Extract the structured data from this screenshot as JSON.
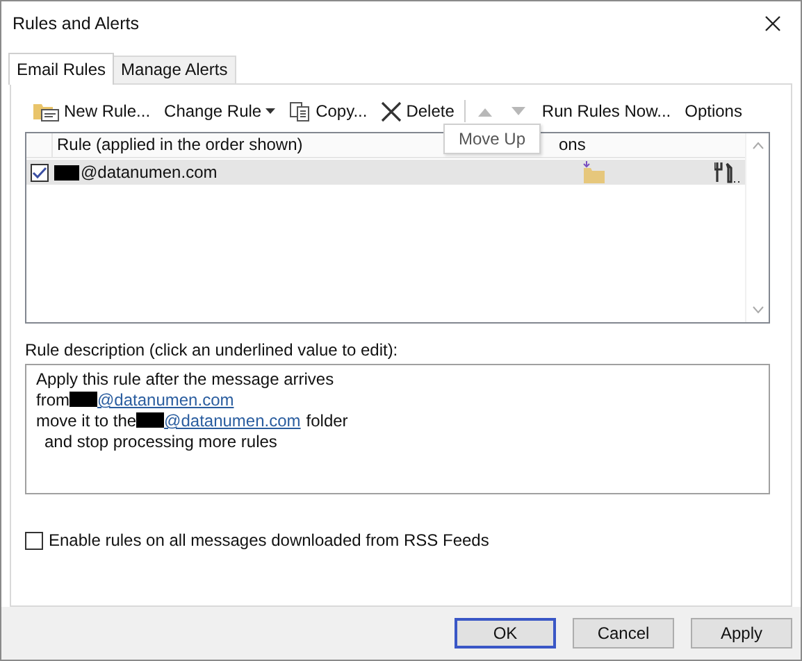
{
  "window": {
    "title": "Rules and Alerts"
  },
  "tabs": [
    {
      "label": "Email Rules",
      "selected": true
    },
    {
      "label": "Manage Alerts",
      "selected": false
    }
  ],
  "toolbar": [
    {
      "kind": "new",
      "label": "New Rule...",
      "disabled": false
    },
    {
      "kind": "dropdown",
      "label": "Change Rule",
      "disabled": false
    },
    {
      "kind": "copy",
      "label": "Copy...",
      "disabled": false
    },
    {
      "kind": "delete",
      "label": "Delete",
      "disabled": false
    },
    {
      "kind": "up",
      "disabled": true
    },
    {
      "kind": "down",
      "disabled": true
    },
    {
      "kind": "text",
      "label": "Run Rules Now...",
      "disabled": false
    },
    {
      "kind": "text",
      "label": "Options",
      "disabled": false
    }
  ],
  "tooltip": "Move Up",
  "rules_table": {
    "columns": [
      "Rule (applied in the order shown)",
      "ons"
    ],
    "rows": [
      {
        "name": "@datanumen.com",
        "checked": true,
        "selected": true
      }
    ]
  },
  "description": {
    "label": "Rule description (click an underlined value to edit):",
    "lines": [
      {
        "text": "Apply this rule after the message arrives",
        "indented": false
      },
      {
        "text": "from",
        "link": "@datanumen.com",
        "indented": false
      },
      {
        "text": "move it to the",
        "link": "@datanumen.com",
        "after": "folder",
        "indented": false
      },
      {
        "text": "and stop processing more rules",
        "indented": true
      }
    ]
  },
  "rss_option": {
    "label": "Enable rules on all messages downloaded from RSS Feeds",
    "checked": false
  },
  "buttons": [
    {
      "label": "OK",
      "default": true
    },
    {
      "label": "Cancel",
      "default": false
    },
    {
      "label": "Apply",
      "default": false
    }
  ]
}
